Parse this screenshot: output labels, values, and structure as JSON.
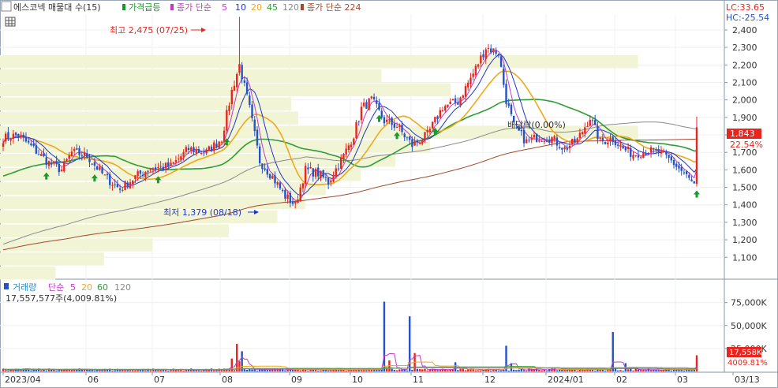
{
  "legend_top": {
    "title": "에스코넥 매물대 수(15)",
    "item_surge": "가격급등",
    "ma_label": "종가 단순",
    "ma5": "5",
    "ma10": "10",
    "ma20": "20",
    "ma45": "45",
    "ma120": "120",
    "ma224_label": "종가 단순 224"
  },
  "legend_bottom": {
    "title": "거래량",
    "ma_label": "단순",
    "ma5": "5",
    "ma20": "20",
    "ma60": "60",
    "ma120": "120",
    "volume_readout": "17,557,577주(4,009.81%)"
  },
  "lc_hc": {
    "lc": "LC:33.65",
    "hc": "HC:-25.54"
  },
  "annotations": {
    "high": "최고 2,475 (07/25)",
    "low": "최저 1,379 (08/18)",
    "dividend": "배당락(0.00%)"
  },
  "price_tag": {
    "value": "1,843",
    "pct": "22.54%"
  },
  "volume_tag": {
    "value": "17,558K",
    "pct": "4009.81%"
  },
  "colors": {
    "up": "#e8261f",
    "down": "#2453c7",
    "ma5": "#c239c9",
    "ma10": "#1e37c4",
    "ma20": "#f0a81a",
    "ma45": "#2f9e35",
    "ma120": "#8a8a8a",
    "ma224": "#a04a2a",
    "volume_profile": "#f1f5d6",
    "surge_marker": "#199a2a"
  },
  "chart_data": {
    "type": "candlestick",
    "x_ticks": [
      "2023/04",
      "06",
      "07",
      "08",
      "09",
      "10",
      "11",
      "12",
      "2024/01",
      "02",
      "03",
      "03/13"
    ],
    "price_axis": {
      "ticks": [
        "1,100",
        "1,200",
        "1,300",
        "1,400",
        "1,500",
        "1,600",
        "1,700",
        "1,800",
        "1,900",
        "2,000",
        "2,100",
        "2,200",
        "2,300",
        "2,400"
      ],
      "ylim": [
        1020,
        2490
      ]
    },
    "volume_axis": {
      "ticks": [
        "25,000K",
        "50,000K",
        "75,000K"
      ],
      "ylim": [
        0,
        85000
      ]
    },
    "high": {
      "value": 2475,
      "date": "07/25"
    },
    "low": {
      "value": 1379,
      "date": "08/18"
    },
    "last_close": 1843,
    "last_change_pct": 22.54,
    "last_volume_k": 17558,
    "close_anchors": [
      [
        0,
        1780
      ],
      [
        6,
        1800
      ],
      [
        12,
        1720
      ],
      [
        18,
        1640
      ],
      [
        23,
        1600
      ],
      [
        27,
        1700
      ],
      [
        33,
        1680
      ],
      [
        40,
        1560
      ],
      [
        46,
        1490
      ],
      [
        52,
        1560
      ],
      [
        58,
        1610
      ],
      [
        66,
        1620
      ],
      [
        73,
        1720
      ],
      [
        80,
        1700
      ],
      [
        86,
        1780
      ],
      [
        90,
        2050
      ],
      [
        93,
        2200
      ],
      [
        97,
        1950
      ],
      [
        101,
        1650
      ],
      [
        106,
        1560
      ],
      [
        111,
        1450
      ],
      [
        115,
        1400
      ],
      [
        119,
        1600
      ],
      [
        124,
        1580
      ],
      [
        128,
        1530
      ],
      [
        134,
        1680
      ],
      [
        138,
        1800
      ],
      [
        141,
        1950
      ],
      [
        145,
        2000
      ],
      [
        150,
        1880
      ],
      [
        155,
        1850
      ],
      [
        161,
        1740
      ],
      [
        167,
        1800
      ],
      [
        173,
        1960
      ],
      [
        179,
        1990
      ],
      [
        185,
        2150
      ],
      [
        190,
        2300
      ],
      [
        195,
        2270
      ],
      [
        198,
        2000
      ],
      [
        201,
        1850
      ],
      [
        206,
        1760
      ],
      [
        211,
        1790
      ],
      [
        216,
        1780
      ],
      [
        221,
        1720
      ],
      [
        226,
        1770
      ],
      [
        231,
        1900
      ],
      [
        235,
        1760
      ],
      [
        240,
        1780
      ],
      [
        244,
        1720
      ],
      [
        248,
        1690
      ],
      [
        253,
        1710
      ],
      [
        258,
        1700
      ],
      [
        263,
        1650
      ],
      [
        268,
        1580
      ],
      [
        272,
        1510
      ],
      [
        273,
        1843
      ]
    ],
    "volume_profile_rows": [
      0.92,
      0.55,
      0.65,
      0.42,
      0.43,
      0.92,
      0.62,
      0.57,
      0.52,
      0.47,
      0.44,
      0.4,
      0.33,
      0.22,
      0.15,
      0.08
    ]
  }
}
